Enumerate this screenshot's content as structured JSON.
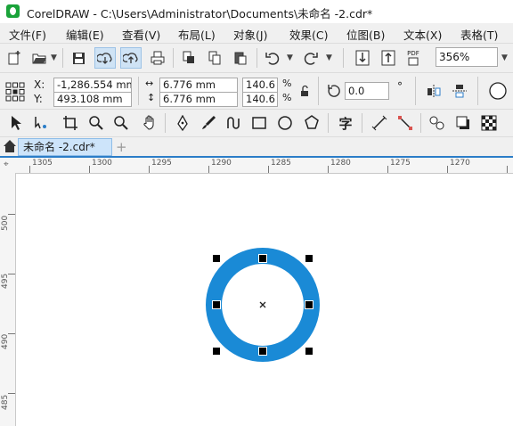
{
  "window": {
    "title": "CorelDRAW - C:\\Users\\Administrator\\Documents\\未命名 -2.cdr*"
  },
  "menu": [
    "文件(F)",
    "编辑(E)",
    "查看(V)",
    "布局(L)",
    "对象(J)",
    "效果(C)",
    "位图(B)",
    "文本(X)",
    "表格(T)"
  ],
  "standard_toolbar": {
    "zoom_value": "356%",
    "pdf_label": "PDF"
  },
  "property_bar": {
    "x_label": "X:",
    "y_label": "Y:",
    "x_value": "-1,286.554 mm",
    "y_value": "493.108 mm",
    "width_value": "6.776 mm",
    "height_value": "6.776 mm",
    "scale_w": "140.6",
    "scale_h": "140.6",
    "percent": "%",
    "rotation_value": "0.0",
    "degree": "°"
  },
  "tools": {
    "text_tool_glyph": "字"
  },
  "document_tab": {
    "label": "未命名 -2.cdr*",
    "add_label": "+"
  },
  "ruler": {
    "horizontal_labels": [
      "1305",
      "1300",
      "1295",
      "1290",
      "1285",
      "1280",
      "1275",
      "1270"
    ],
    "vertical_labels": [
      "500",
      "495",
      "490",
      "485"
    ]
  },
  "colors": {
    "ring": "#1a8ad6",
    "accent": "#2b7dc8",
    "tab_active": "#cde4fa"
  }
}
